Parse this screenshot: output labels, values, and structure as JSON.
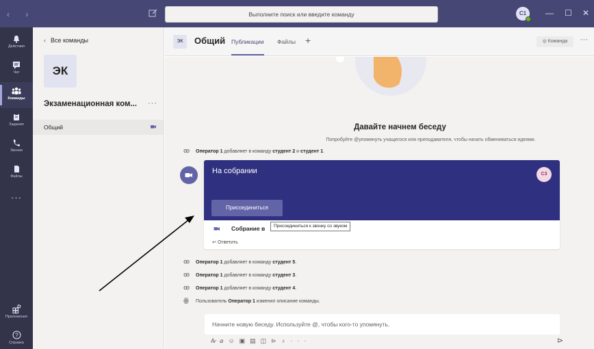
{
  "titlebar": {
    "search_placeholder": "Выполните поиск или введите команду",
    "user_initials": "С1",
    "minimize": "—",
    "maximize": "☐",
    "close": "✕"
  },
  "rail": {
    "items": [
      {
        "label": "Действия",
        "icon": "bell-icon"
      },
      {
        "label": "Чат",
        "icon": "chat-icon"
      },
      {
        "label": "Команды",
        "icon": "teams-icon"
      },
      {
        "label": "Задания",
        "icon": "assignments-icon"
      },
      {
        "label": "Звонки",
        "icon": "phone-icon"
      },
      {
        "label": "Файлы",
        "icon": "files-icon"
      },
      {
        "label": "",
        "icon": "more-icon"
      },
      {
        "label": "Приложения",
        "icon": "apps-icon"
      },
      {
        "label": "Справка",
        "icon": "help-icon"
      }
    ]
  },
  "teampanel": {
    "back_label": "Все команды",
    "team_initials": "ЭК",
    "team_name": "Экзаменационная ком...",
    "more": "···",
    "channel": "Общий"
  },
  "header": {
    "avatar": "ЭК",
    "title": "Общий",
    "tabs": [
      "Публикации",
      "Файлы"
    ],
    "add_tab": "+",
    "team_button": "◎ Команда",
    "more": "···"
  },
  "feed": {
    "welcome_title": "Давайте начнем беседу",
    "welcome_subtitle": "Попробуйте @упомянуть учащегося или преподавателя, чтобы начать обмениваться идеями.",
    "system_messages_top": [
      {
        "actor": "Оператор 1",
        "text": " добавляет в команду ",
        "target": "студент 2",
        "joiner": " и ",
        "target2": "студент 1",
        "end": "."
      }
    ],
    "meeting": {
      "title": "На собрании",
      "avatar": "С3",
      "join_button": "Присоединиться",
      "row_label": "Собрание в",
      "tooltip": "Присоединиться к звонку со звуком",
      "reply": "Ответить"
    },
    "system_messages_bottom": [
      {
        "actor": "Оператор 1",
        "text": " добавляет в команду ",
        "target": "студент 5",
        "end": "."
      },
      {
        "actor": "Оператор 1",
        "text": " добавляет в команду ",
        "target": "студент 3",
        "end": "."
      },
      {
        "actor": "Оператор 1",
        "text": " добавляет в команду ",
        "target": "студент 4",
        "end": "."
      },
      {
        "actor_prefix": "Пользователь ",
        "actor": "Оператор 1",
        "text": " изменил описание команды.",
        "target": "",
        "end": ""
      }
    ]
  },
  "compose": {
    "placeholder": "Начните новую беседу. Используйте @, чтобы кого-то упомянуть.",
    "tools": [
      "format-icon",
      "attach-icon",
      "emoji-icon",
      "gif-icon",
      "sticker-icon",
      "meet-icon",
      "praise-icon",
      "more-options-icon"
    ],
    "more": "···"
  },
  "colors": {
    "titlebar": "#464775",
    "rail": "#33344a",
    "accent": "#6264a7",
    "meeting_banner": "#2f3180"
  }
}
